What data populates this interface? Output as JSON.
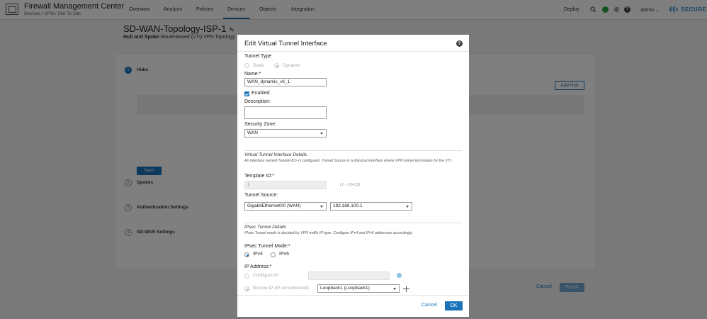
{
  "app": {
    "title": "Firewall Management Center",
    "breadcrumb": "Devices / VPN / Site To Site",
    "nav": [
      "Overview",
      "Analysis",
      "Policies",
      "Devices",
      "Objects",
      "Integration"
    ],
    "deploy_label": "Deploy",
    "user_label": "admin",
    "brand_label": "SECURE",
    "accent_color": "#1a73b8",
    "status_color": "#2ea043"
  },
  "page": {
    "title": "SD-WAN-Topology-ISP-1",
    "subtitle_bold": "Hub and Spoke",
    "subtitle_rest": "Route-Based (VTI) VPN Topology",
    "steps": [
      {
        "num": "1",
        "label": "Hubs"
      },
      {
        "num": "2",
        "label": "Spokes"
      },
      {
        "num": "3",
        "label": "Authentication Settings"
      },
      {
        "num": "4",
        "label": "SD-WAN Settings"
      }
    ],
    "add_hub_label": "Add Hub",
    "next_label": "Next",
    "cancel_label": "Cancel",
    "finish_label": "Finish"
  },
  "modal": {
    "title": "Edit Virtual Tunnel Interface",
    "tunnel_type_label": "Tunnel Type",
    "tunnel_type_options": [
      "Static",
      "Dynamic"
    ],
    "tunnel_type_selected": "Dynamic",
    "name_label": "Name:*",
    "name_value": "WAN_dynamic_vti_1",
    "enabled_label": "Enabled",
    "enabled_checked": true,
    "description_label": "Description:",
    "description_value": "",
    "security_zone_label": "Security Zone:",
    "security_zone_value": "WAN",
    "vti_details_title": "Virtual Tunnel Interface Details",
    "vti_details_desc": "An interface named Tunnel<ID> is configured. Tunnel Source is a physical interface where VPN tunnel terminates for the VTI.",
    "template_id_label": "Template ID:*",
    "template_id_value": "1",
    "template_id_hint": "(1 - 10413)",
    "tunnel_source_label": "Tunnel Source:",
    "tunnel_source_interface": "GigabitEthernet0/0 (WAN)",
    "tunnel_source_ip": "192.168.100.1",
    "ipsec_details_title": "IPsec Tunnel Details",
    "ipsec_details_desc": "IPsec Tunnel mode is decided by VPN traffic IP type. Configure IPv4 and IPv6 addresses accordingly.",
    "ipsec_mode_label": "IPsec Tunnel Mode:*",
    "ipsec_mode_options": [
      "IPv4",
      "IPv6"
    ],
    "ipsec_mode_selected": "IPv4",
    "ip_address_label": "IP Address:*",
    "configure_ip_label": "Configure IP",
    "configure_ip_value": "",
    "borrow_ip_label": "Borrow IP (IP unnumbered)",
    "borrow_ip_value": "Loopback1 (Loopback1)",
    "cancel_label": "Cancel",
    "ok_label": "OK"
  }
}
